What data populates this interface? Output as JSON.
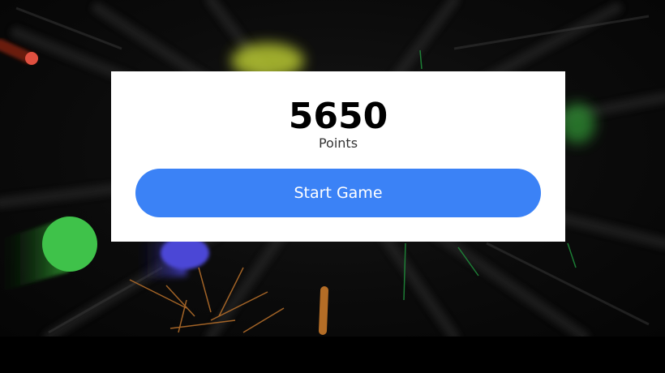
{
  "game": {
    "score": "5650",
    "score_label": "Points",
    "start_label": "Start Game"
  },
  "colors": {
    "button": "#3b82f6",
    "modal_bg": "#ffffff",
    "background": "#000000"
  }
}
